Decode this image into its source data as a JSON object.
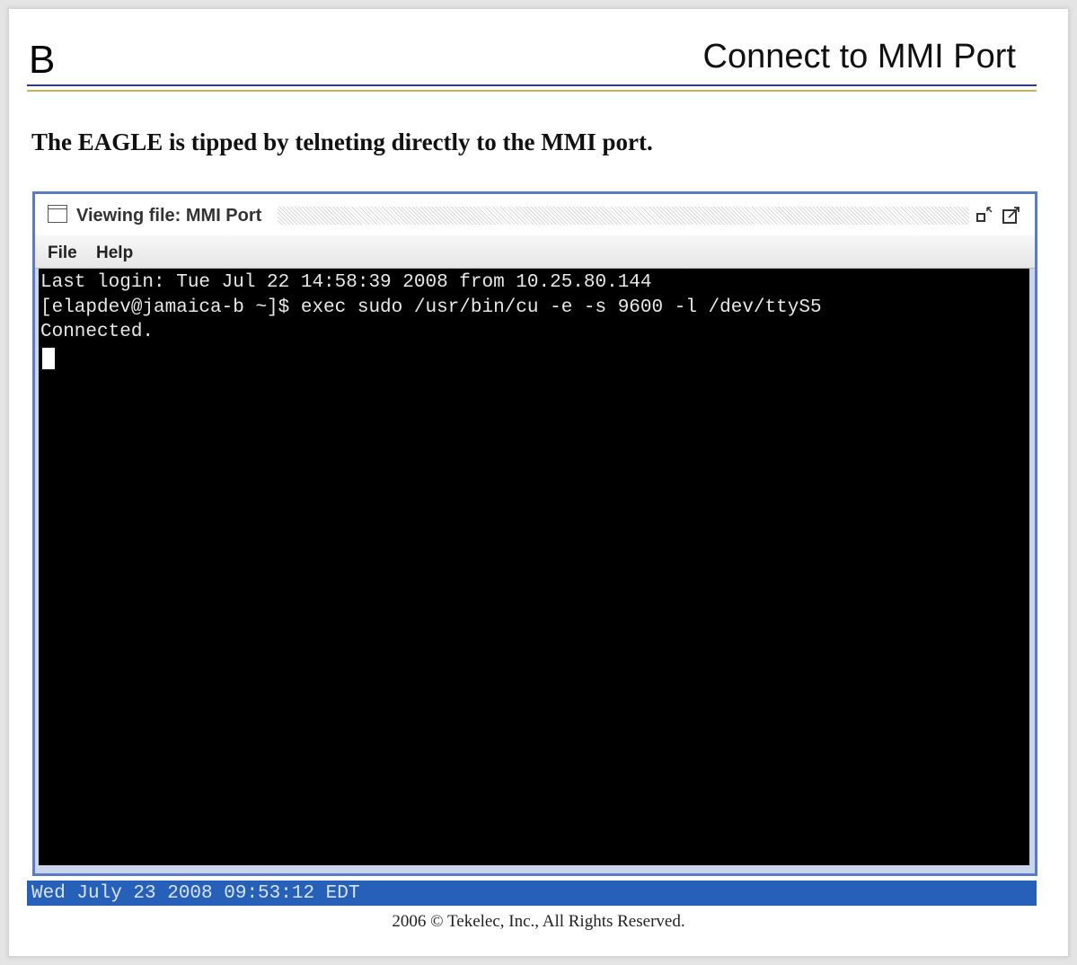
{
  "slide": {
    "letter": "B",
    "title": "Connect to MMI Port",
    "subtitle": "The EAGLE is tipped by telneting directly to the MMI port."
  },
  "window": {
    "title": "Viewing file: MMI Port",
    "icons": {
      "window": "window-icon",
      "minimize": "minimize-icon",
      "maximize": "maximize-icon"
    },
    "menu": [
      "File",
      "Help"
    ]
  },
  "terminal": {
    "lines": [
      "Last login: Tue Jul 22 14:58:39 2008 from 10.25.80.144",
      "[elapdev@jamaica-b ~]$ exec sudo /usr/bin/cu -e -s 9600 -l /dev/ttyS5",
      "Connected."
    ]
  },
  "status": {
    "datetime": "Wed July 23 2008 09:53:12 EDT"
  },
  "footer": {
    "copyright": "2006 © Tekelec, Inc., All Rights Reserved."
  },
  "colors": {
    "window_border": "#5b7cc4",
    "status_bar": "#2760b8",
    "rule_top": "#2b3a8a",
    "rule_bottom": "#c8b25a"
  }
}
